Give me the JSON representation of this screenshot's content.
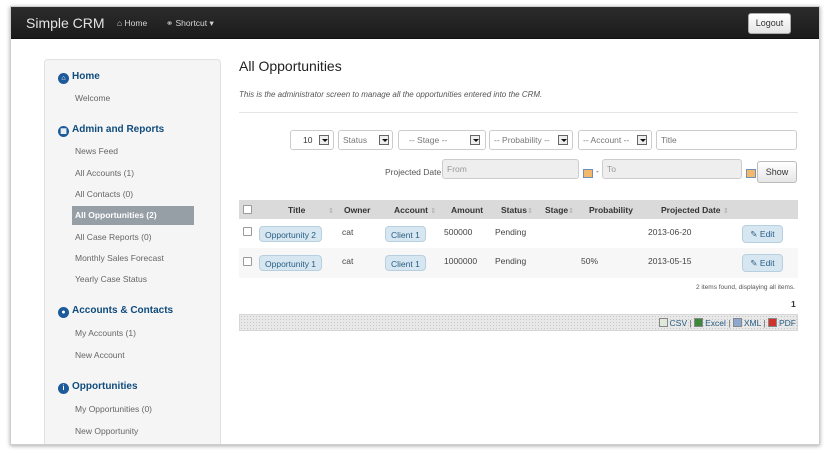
{
  "navbar": {
    "brand": "Simple CRM",
    "home": "Home",
    "shortcut": "Shortcut",
    "logout": "Logout"
  },
  "sidebar": {
    "home_header": "Home",
    "welcome": "Welcome",
    "admin_header": "Admin and Reports",
    "news_feed": "News Feed",
    "all_accounts": "All Accounts (1)",
    "all_contacts": "All Contacts (0)",
    "all_opportunities": "All Opportunities (2)",
    "all_case_reports": "All Case Reports (0)",
    "monthly_sales_forecast": "Monthly Sales Forecast",
    "yearly_case_status": "Yearly Case Status",
    "accounts_header": "Accounts & Contacts",
    "my_accounts": "My Accounts (1)",
    "new_account": "New Account",
    "opportunities_header": "Opportunities",
    "my_opportunities": "My Opportunities (0)",
    "new_opportunity": "New Opportunity"
  },
  "main": {
    "title": "All Opportunities",
    "intro": "This is the administrator screen to manage all the opportunities entered into the CRM."
  },
  "filters": {
    "page_size": "10",
    "status": "Status",
    "stage": "-- Stage --",
    "probability": "-- Probability --",
    "account": "-- Account --",
    "title_placeholder": "Title",
    "projected_date_label": "Projected Date",
    "from_placeholder": "From",
    "dash": "-",
    "to_placeholder": "To",
    "show": "Show"
  },
  "table": {
    "headers": {
      "title": "Title",
      "owner": "Owner",
      "account": "Account",
      "amount": "Amount",
      "status": "Status",
      "stage": "Stage",
      "probability": "Probability",
      "projected_date": "Projected Date"
    },
    "rows": [
      {
        "title": "Opportunity 2",
        "owner": "cat",
        "account": "Client 1",
        "amount": "500000",
        "status": "Pending",
        "stage": "",
        "probability": "",
        "projected_date": "2013-06-20",
        "edit": "Edit"
      },
      {
        "title": "Opportunity 1",
        "owner": "cat",
        "account": "Client 1",
        "amount": "1000000",
        "status": "Pending",
        "stage": "",
        "probability": "50%",
        "projected_date": "2013-05-15",
        "edit": "Edit"
      }
    ],
    "summary": "2 items found, displaying all items.",
    "page": "1"
  },
  "exports": {
    "csv": "CSV",
    "excel": "Excel",
    "xml": "XML",
    "pdf": "PDF",
    "separator": "|"
  },
  "colors": {
    "navbar": "#1b1b1b",
    "sidebar_header": "#0f4b7c",
    "sidebar_active": "#969ea6",
    "pill": "#d7e7f1"
  }
}
